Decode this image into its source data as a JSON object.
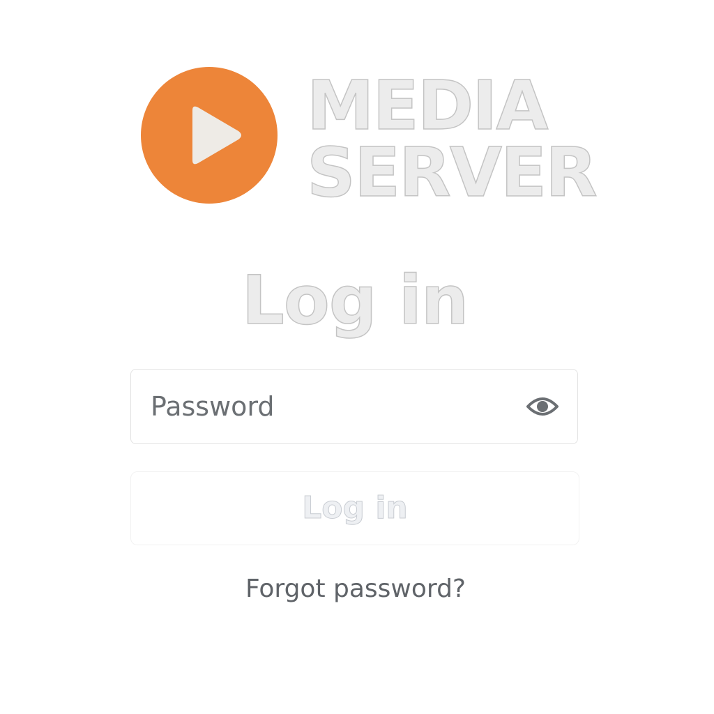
{
  "branding": {
    "logo_icon": "play-icon",
    "logo_color": "#ed8539",
    "name_line1": "MEDIA",
    "name_line2": "SERVER"
  },
  "login": {
    "heading": "Log in",
    "password_placeholder": "Password",
    "password_value": "",
    "show_password_icon": "eye-icon",
    "submit_label": "Log in",
    "forgot_link": "Forgot password?"
  }
}
